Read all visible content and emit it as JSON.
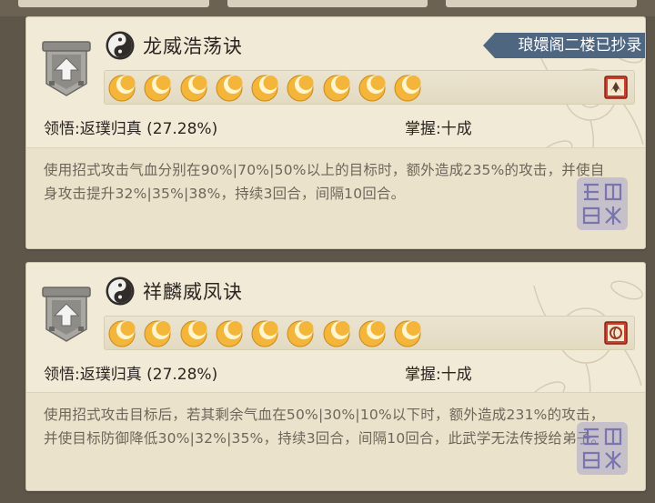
{
  "banner": {
    "text": "琅嬛阁二楼已抄录"
  },
  "skills": [
    {
      "name": "龙威浩荡诀",
      "comprehension": "领悟:返璞归真 (27.28%)",
      "mastery": "掌握:十成",
      "description": "使用招式攻击气血分别在90%|70%|50%以上的目标时，额外造成235%的攻击，并使自身攻击提升32%|35%|38%，持续3回合，间隔10回合。",
      "moons": 9,
      "rank_icon": "beast-emblem-icon"
    },
    {
      "name": "祥麟威凤诀",
      "comprehension": "领悟:返璞归真 (27.28%)",
      "mastery": "掌握:十成",
      "description": "使用招式攻击目标后，若其剩余气血在50%|30%|10%以下时，额外造成231%的攻击，并使目标防御降低30%|32%|35%，持续3回合，间隔10回合，此武学无法传授给弟子。",
      "moons": 9,
      "rank_icon": "phoenix-emblem-icon"
    }
  ],
  "colors": {
    "card_bg": "#f1ead7",
    "desc_bg": "#ebe2cb",
    "banner_bg": "#4f6680",
    "moon_gold": "#f3b63a",
    "text_dark": "#2a2520",
    "text_desc": "#6e655a",
    "seal_blue": "#8a86c2"
  }
}
